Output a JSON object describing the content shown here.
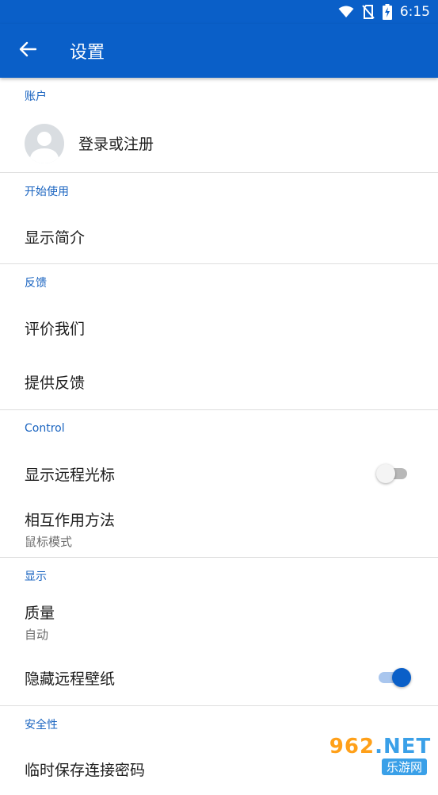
{
  "status_bar": {
    "time": "6:15",
    "icons": [
      "wifi-icon",
      "no-sim-icon",
      "battery-charging-icon"
    ]
  },
  "app_bar": {
    "title": "设置",
    "back_icon": "arrow-back-icon"
  },
  "sections": {
    "account": {
      "header": "账户",
      "login_label": "登录或注册"
    },
    "getting_started": {
      "header": "开始使用",
      "show_intro": "显示简介"
    },
    "feedback": {
      "header": "反馈",
      "rate_us": "评价我们",
      "give_feedback": "提供反馈"
    },
    "control": {
      "header": "Control",
      "show_remote_cursor": "显示远程光标",
      "show_remote_cursor_on": false,
      "interaction_method": "相互作用方法",
      "interaction_method_value": "鼠标模式"
    },
    "display": {
      "header": "显示",
      "quality": "质量",
      "quality_value": "自动",
      "hide_wallpaper": "隐藏远程壁纸",
      "hide_wallpaper_on": true
    },
    "security": {
      "header": "安全性",
      "save_password": "临时保存连接密码"
    }
  },
  "watermark": {
    "top_num": "962",
    "top_dot": ".",
    "top_net": "NET",
    "bottom": "乐游网"
  },
  "colors": {
    "primary": "#0a5fc8",
    "section_header": "#1a64c0"
  }
}
